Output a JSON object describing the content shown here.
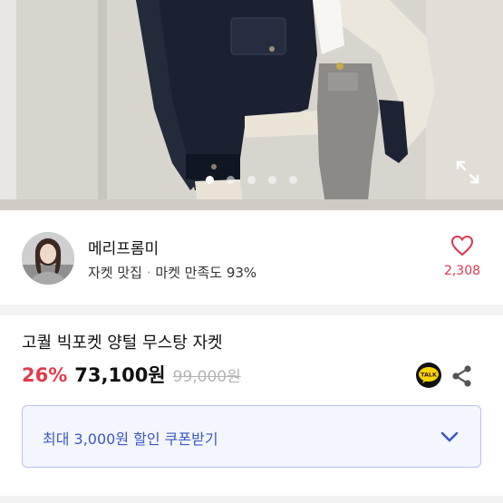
{
  "gallery": {
    "dots": [
      true,
      false,
      false,
      false,
      false
    ]
  },
  "seller": {
    "name": "메리프롬미",
    "category": "자켓 맛집",
    "separator": "·",
    "satisfaction": "마켓 만족도 93%",
    "likes": "2,308"
  },
  "product": {
    "title": "고퀄 빅포켓 양털 무스탕 자켓",
    "discount": "26%",
    "price": "73,100원",
    "original_price": "99,000원",
    "talk_label": "TALK"
  },
  "coupon": {
    "label": "최대 3,000원 할인 쿠폰받기"
  },
  "colors": {
    "accent_red": "#e23b4d",
    "coupon_blue": "#3a57c4",
    "kakao_yellow": "#f6d600"
  }
}
